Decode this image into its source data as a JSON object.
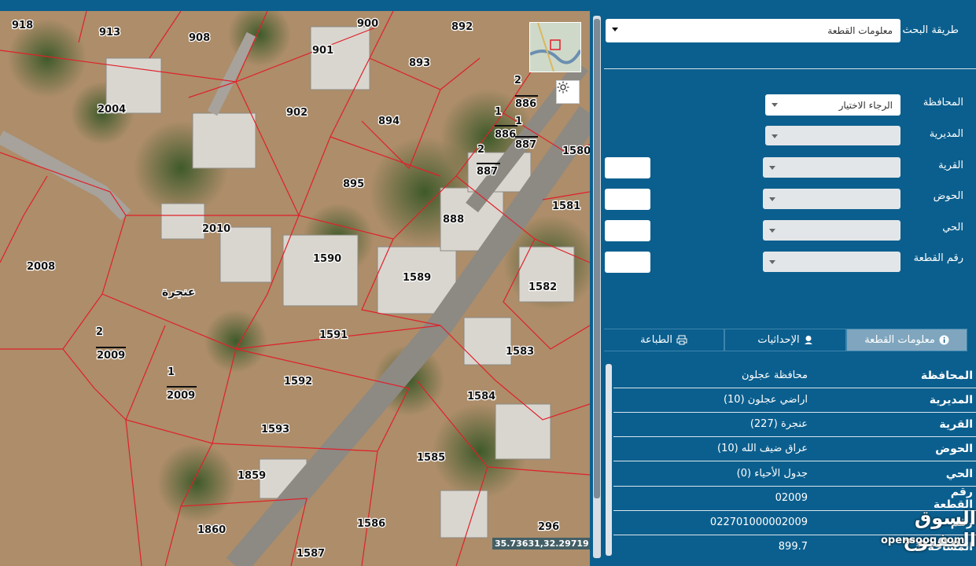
{
  "map": {
    "parcels": [
      "918",
      "913",
      "908",
      "900",
      "892",
      "901",
      "893",
      "2004",
      "902",
      "894",
      "886",
      "887",
      "2",
      "1",
      "1580",
      "895",
      "888",
      "1581",
      "2010",
      "2008",
      "1590",
      "1589",
      "1582",
      "1591",
      "1583",
      "2009",
      "1592",
      "1584",
      "1593",
      "1585",
      "1859",
      "1860",
      "1586",
      "1587",
      "296"
    ],
    "parcel_small": [
      "2",
      "1",
      "1",
      "2",
      "2",
      "1"
    ],
    "village_label": "عنجرة",
    "coordinates": "35.73631,32.29719",
    "sun_icon": "sun-icon",
    "watermark": {
      "main": "السوق المفتوح",
      "sub": "opensooq.com"
    }
  },
  "search": {
    "method_label": "طريقة البحث",
    "method_value": "معلومات القطعة"
  },
  "form": {
    "governorate_label": "المحافظة",
    "governorate_placeholder": "الرجاء الاختيار",
    "directorate_label": "المديرية",
    "village_label": "القرية",
    "basin_label": "الحوض",
    "district_label": "الحي",
    "parcel_label": "رقم القطعة"
  },
  "tabs": [
    {
      "label": "معلومات القطعة",
      "icon": "info-icon"
    },
    {
      "label": "الإحداثيات",
      "icon": "map-pin-icon"
    },
    {
      "label": "الطباعة",
      "icon": "printer-icon"
    }
  ],
  "info": [
    {
      "key": "المحافظة",
      "value": "محافظة عجلون"
    },
    {
      "key": "المديرية",
      "value": "اراضي عجلون (10)"
    },
    {
      "key": "القرية",
      "value": "عنجرة (227)"
    },
    {
      "key": "الحوض",
      "value": "عراق ضيف الله (10)"
    },
    {
      "key": "الحي",
      "value": "جدول الأحياء (0)"
    },
    {
      "key": "رقم القطعة",
      "value": "02009"
    },
    {
      "key": "رقم",
      "value": "022701000002009"
    },
    {
      "key": "المساحة**",
      "value": "899.7"
    }
  ],
  "colors": {
    "panel": "#0b5f8e",
    "parcel_line": "#e0202a"
  }
}
